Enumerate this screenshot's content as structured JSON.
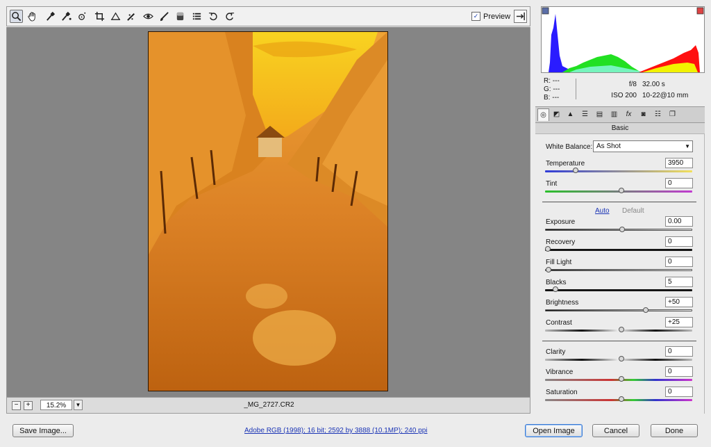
{
  "toolbar": {
    "tools": [
      "zoom-tool-icon",
      "hand-tool-icon",
      "white-balance-tool-icon",
      "color-sampler-tool-icon",
      "targeted-adjustment-tool-icon",
      "crop-tool-icon",
      "straighten-tool-icon",
      "spot-removal-tool-icon",
      "red-eye-removal-tool-icon",
      "adjustment-brush-icon",
      "graduated-filter-icon",
      "preferences-icon",
      "rotate-left-icon",
      "rotate-right-icon"
    ],
    "preview_label": "Preview",
    "preview_checked": true
  },
  "statusbar": {
    "zoom_out": "−",
    "zoom_in": "+",
    "zoom": "15.2%",
    "filename": "_MG_2727.CR2"
  },
  "info": {
    "r_label": "R:",
    "r_value": "---",
    "g_label": "G:",
    "g_value": "---",
    "b_label": "B:",
    "b_value": "---",
    "aperture": "f/8",
    "shutter": "32.00 s",
    "iso": "ISO 200",
    "lens": "10-22@10 mm"
  },
  "panel": {
    "title": "Basic",
    "white_balance_label": "White Balance:",
    "white_balance_value": "As Shot",
    "auto_label": "Auto",
    "default_label": "Default",
    "sliders": {
      "temperature": {
        "label": "Temperature",
        "value": "3950",
        "position": 0.19
      },
      "tint": {
        "label": "Tint",
        "value": "0",
        "position": 0.5
      },
      "exposure": {
        "label": "Exposure",
        "value": "0.00",
        "position": 0.5
      },
      "recovery": {
        "label": "Recovery",
        "value": "0",
        "position": 0.0
      },
      "fill_light": {
        "label": "Fill Light",
        "value": "0",
        "position": 0.0
      },
      "blacks": {
        "label": "Blacks",
        "value": "5",
        "position": 0.05
      },
      "brightness": {
        "label": "Brightness",
        "value": "+50",
        "position": 0.66
      },
      "contrast": {
        "label": "Contrast",
        "value": "+25",
        "position": 0.5
      },
      "clarity": {
        "label": "Clarity",
        "value": "0",
        "position": 0.5
      },
      "vibrance": {
        "label": "Vibrance",
        "value": "0",
        "position": 0.5
      },
      "saturation": {
        "label": "Saturation",
        "value": "0",
        "position": 0.5
      }
    }
  },
  "footer": {
    "save_label": "Save Image...",
    "workflow_link": "Adobe RGB (1998); 16 bit; 2592 by 3888 (10.1MP); 240 ppi",
    "open_label": "Open Image",
    "cancel_label": "Cancel",
    "done_label": "Done"
  },
  "colors": {
    "accent": "#3b7bd4",
    "histogram_blue": "#2a1cff",
    "histogram_green": "#22e022",
    "histogram_red": "#ff1010",
    "histogram_yellow": "#f2f200"
  }
}
